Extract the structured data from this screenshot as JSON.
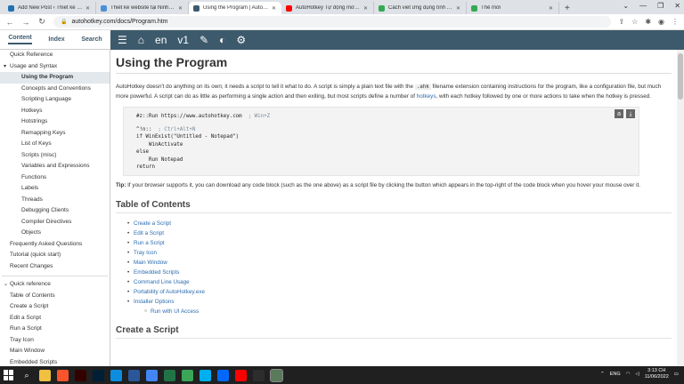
{
  "browser": {
    "tabs": [
      {
        "label": "Add New Post ‹ Thiết kế web…",
        "color": "#2271b1",
        "active": false
      },
      {
        "label": "Thiết kế website tại Ninh Bìn…",
        "color": "#4a90d9",
        "active": false
      },
      {
        "label": "Using the Program | AutoHo…",
        "color": "#3d5a6c",
        "active": true
      },
      {
        "label": "AutoHotkey Tự động mở VP…",
        "color": "#ff0000",
        "active": false
      },
      {
        "label": "Cách viết ứng dụng tính AutoHo…",
        "color": "#34a853",
        "active": false
      },
      {
        "label": "Thẻ mới",
        "color": "#34a853",
        "active": false
      }
    ],
    "new_tab_symbol": "+",
    "window_controls": [
      "⌄",
      "—",
      "❐",
      "✕"
    ],
    "url": "autohotkey.com/docs/Program.htm"
  },
  "docnav": {
    "side_tabs": [
      "Content",
      "Index",
      "Search"
    ],
    "lang": "en",
    "version": "v1",
    "icons": [
      "menu-icon",
      "home-icon",
      "edit-icon",
      "theme-icon",
      "settings-icon"
    ]
  },
  "sidebar": {
    "items": [
      {
        "label": "Quick Reference",
        "level": 0,
        "caret": ""
      },
      {
        "label": "Usage and Syntax",
        "level": -1,
        "caret": "▾"
      },
      {
        "label": "Using the Program",
        "level": 1,
        "selected": true
      },
      {
        "label": "Concepts and Conventions",
        "level": 1
      },
      {
        "label": "Scripting Language",
        "level": 1
      },
      {
        "label": "Hotkeys",
        "level": 1
      },
      {
        "label": "Hotstrings",
        "level": 1
      },
      {
        "label": "Remapping Keys",
        "level": 1
      },
      {
        "label": "List of Keys",
        "level": 1
      },
      {
        "label": "Scripts (misc)",
        "level": 1
      },
      {
        "label": "Variables and Expressions",
        "level": 1
      },
      {
        "label": "Functions",
        "level": 1
      },
      {
        "label": "Labels",
        "level": 1
      },
      {
        "label": "Threads",
        "level": 1
      },
      {
        "label": "Debugging Clients",
        "level": 1
      },
      {
        "label": "Compiler Directives",
        "level": 1
      },
      {
        "label": "Objects",
        "level": 1
      },
      {
        "label": "Frequently Asked Questions",
        "level": 0
      },
      {
        "label": "Tutorial (quick start)",
        "level": 0
      },
      {
        "label": "Recent Changes",
        "level": 0
      }
    ],
    "quickref_header": "Quick reference",
    "quickref_items": [
      "Table of Contents",
      "Create a Script",
      "Edit a Script",
      "Run a Script",
      "Tray Icon",
      "Main Window",
      "Embedded Scripts"
    ]
  },
  "content": {
    "title": "Using the Program",
    "intro_a": "AutoHotkey doesn't do anything on its own; it needs a script to tell it what to do. A script is simply a plain text file with the ",
    "intro_code": ".ahk",
    "intro_b": " filename extension containing instructions for the program, like a configuration file, but much more powerful. A script can do as little as performing a single action and then exiting, but most scripts define a number of ",
    "intro_link": "hotkeys",
    "intro_c": ", with each hotkey followed by one or more actions to take when the hotkey is pressed.",
    "code_lines": [
      {
        "code": "#z::Run https://www.autohotkey.com",
        "comment": "  ; Win+Z"
      },
      {
        "code": "",
        "comment": ""
      },
      {
        "code": "^!n::",
        "comment": "  ; Ctrl+Alt+N"
      },
      {
        "code": "if WinExist(\"Untitled - Notepad\")",
        "comment": ""
      },
      {
        "code": "    WinActivate",
        "comment": ""
      },
      {
        "code": "else",
        "comment": ""
      },
      {
        "code": "    Run Notepad",
        "comment": ""
      },
      {
        "code": "return",
        "comment": ""
      }
    ],
    "tip_label": "Tip:",
    "tip_text": " If your browser supports it, you can download any code block (such as the one above) as a script file by clicking the button which appears in the top-right of the code block when you hover your mouse over it.",
    "toc_heading": "Table of Contents",
    "toc": [
      {
        "label": "Create a Script",
        "sub": false
      },
      {
        "label": "Edit a Script",
        "sub": false
      },
      {
        "label": "Run a Script",
        "sub": false
      },
      {
        "label": "Tray Icon",
        "sub": false
      },
      {
        "label": "Main Window",
        "sub": false
      },
      {
        "label": "Embedded Scripts",
        "sub": false
      },
      {
        "label": "Command Line Usage",
        "sub": false
      },
      {
        "label": "Portability of AutoHotkey.exe",
        "sub": false
      },
      {
        "label": "Installer Options",
        "sub": false
      },
      {
        "label": "Run with UI Access",
        "sub": true
      }
    ],
    "next_heading": "Create a Script"
  },
  "taskbar": {
    "apps": [
      {
        "name": "explorer",
        "color": "#f0c040"
      },
      {
        "name": "brave",
        "color": "#fb542b"
      },
      {
        "name": "illustrator",
        "color": "#330000"
      },
      {
        "name": "photoshop",
        "color": "#001e36"
      },
      {
        "name": "edge",
        "color": "#0c8de0"
      },
      {
        "name": "word",
        "color": "#2b579a"
      },
      {
        "name": "chrome",
        "color": "#4285f4"
      },
      {
        "name": "excel",
        "color": "#217346"
      },
      {
        "name": "app-green",
        "color": "#3aa657"
      },
      {
        "name": "skype",
        "color": "#00aff0"
      },
      {
        "name": "zalo",
        "color": "#0068ff"
      },
      {
        "name": "youtube",
        "color": "#ff0000"
      },
      {
        "name": "terminal",
        "color": "#2d2d2d"
      },
      {
        "name": "autohotkey",
        "color": "#5a7a5a",
        "active": true
      }
    ],
    "lang": "ENG",
    "time": "3:13 CH",
    "date": "11/06/2022"
  }
}
